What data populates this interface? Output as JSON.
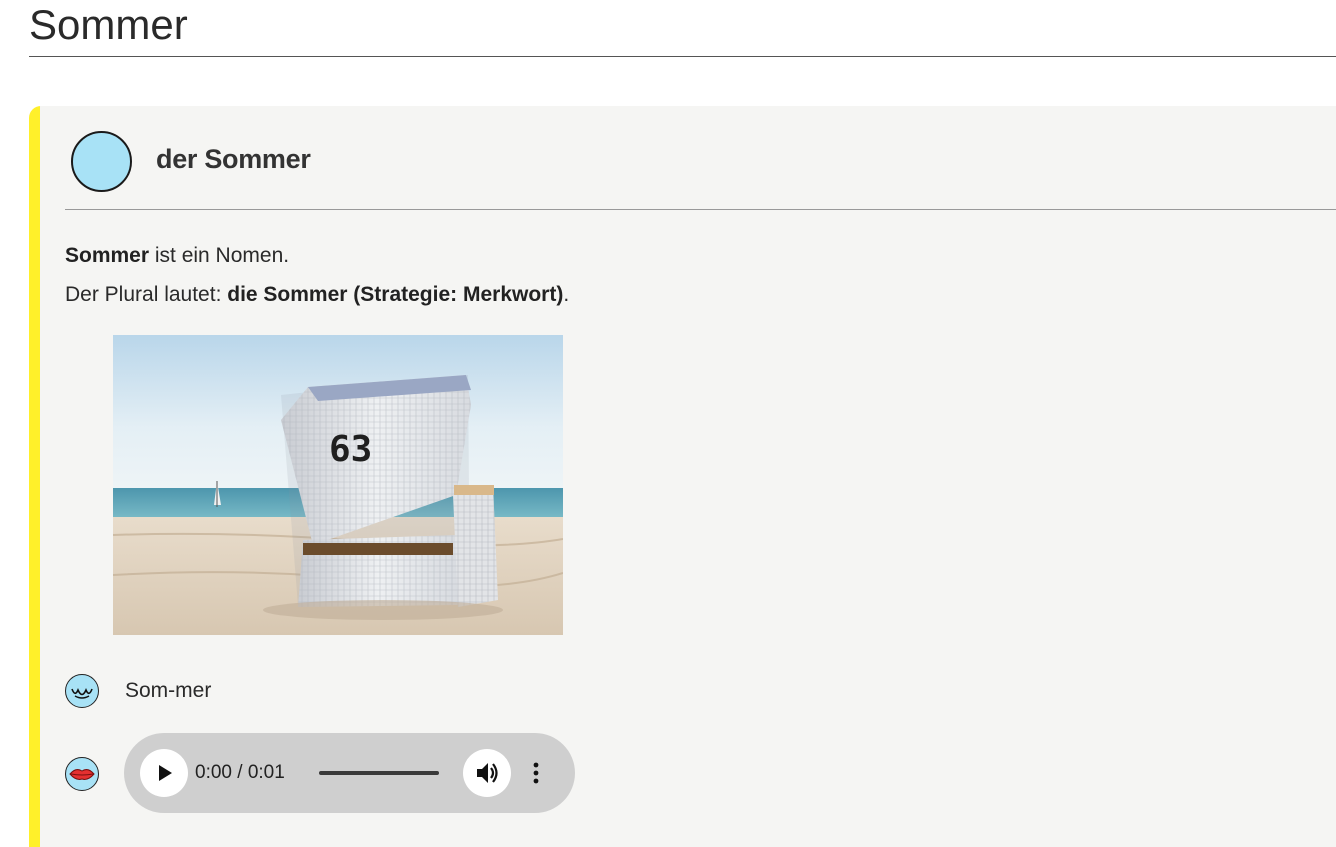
{
  "page": {
    "title": "Sommer"
  },
  "entry": {
    "heading": "der Sommer",
    "gender_color": "#a8e2f6",
    "accent_color": "#fff02a",
    "description": {
      "word": "Sommer",
      "line1_rest": " ist ein Nomen.",
      "line2_prefix": "Der Plural lautet: ",
      "plural": "die Sommer (Strategie: Merkwort)",
      "line2_suffix": "."
    },
    "image": {
      "subject": "beach chair",
      "number": "63"
    },
    "syllables": {
      "icon": "wave-mouth-icon",
      "text": "Som-mer"
    },
    "audio": {
      "icon": "lips-icon",
      "time": "0:00 / 0:01",
      "progress": 0.0
    }
  }
}
